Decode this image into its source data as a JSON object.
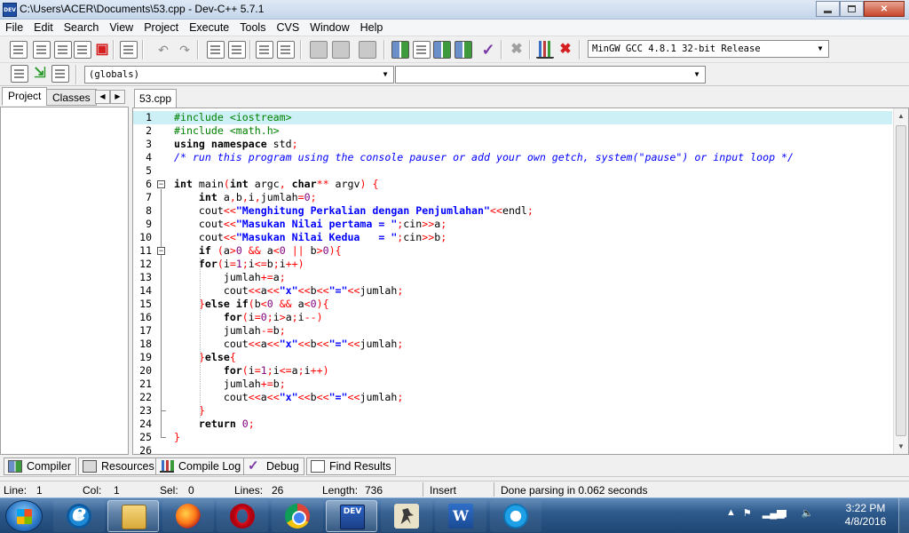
{
  "window": {
    "title": "C:\\Users\\ACER\\Documents\\53.cpp - Dev-C++ 5.7.1",
    "app_icon_label": "DEV"
  },
  "menu": [
    "File",
    "Edit",
    "Search",
    "View",
    "Project",
    "Execute",
    "Tools",
    "CVS",
    "Window",
    "Help"
  ],
  "toolbar": {
    "compiler_select": "MinGW GCC 4.8.1 32-bit Release",
    "globals_select": "(globals)",
    "symbol_select": ""
  },
  "left_panel": {
    "tabs": [
      "Project",
      "Classes"
    ],
    "active_tab": "Project"
  },
  "editor": {
    "file_tab": "53.cpp",
    "current_line": 1,
    "lines": [
      {
        "n": "1",
        "html": "<span class=\"c-pp\">#include &lt;iostream&gt;</span>"
      },
      {
        "n": "2",
        "html": "<span class=\"c-pp\">#include &lt;math.h&gt;</span>"
      },
      {
        "n": "3",
        "html": "<span class=\"c-kw\">using namespace</span> std<span class=\"c-op\">;</span>"
      },
      {
        "n": "4",
        "html": "<span class=\"c-cm\">/* run this program using the console pauser or add your own getch, system(\"pause\") or input loop */</span>"
      },
      {
        "n": "5",
        "html": ""
      },
      {
        "n": "6",
        "html": "<span class=\"c-kw\">int</span> main<span class=\"c-op\">(</span><span class=\"c-kw\">int</span> argc<span class=\"c-op\">,</span> <span class=\"c-kw\">char</span><span class=\"c-op\">**</span> argv<span class=\"c-op\">)</span> <span class=\"c-op\">{</span>"
      },
      {
        "n": "7",
        "html": "    <span class=\"c-kw\">int</span> a<span class=\"c-op\">,</span>b<span class=\"c-op\">,</span>i<span class=\"c-op\">,</span>jumlah<span class=\"c-op\">=</span><span class=\"c-nm\">0</span><span class=\"c-op\">;</span>"
      },
      {
        "n": "8",
        "html": "    cout<span class=\"c-op\">&lt;&lt;</span><span class=\"c-st\">\"Menghitung Perkalian dengan Penjumlahan\"</span><span class=\"c-op\">&lt;&lt;</span>endl<span class=\"c-op\">;</span>"
      },
      {
        "n": "9",
        "html": "    cout<span class=\"c-op\">&lt;&lt;</span><span class=\"c-st\">\"Masukan Nilai pertama = \"</span><span class=\"c-op\">;</span>cin<span class=\"c-op\">&gt;&gt;</span>a<span class=\"c-op\">;</span>"
      },
      {
        "n": "10",
        "html": "    cout<span class=\"c-op\">&lt;&lt;</span><span class=\"c-st\">\"Masukan Nilai Kedua   = \"</span><span class=\"c-op\">;</span>cin<span class=\"c-op\">&gt;&gt;</span>b<span class=\"c-op\">;</span>"
      },
      {
        "n": "11",
        "html": "    <span class=\"c-kw\">if</span> <span class=\"c-op\">(</span>a<span class=\"c-op\">&gt;</span><span class=\"c-nm\">0</span> <span class=\"c-op\">&amp;&amp;</span> a<span class=\"c-op\">&lt;</span><span class=\"c-nm\">0</span> <span class=\"c-op\">||</span> b<span class=\"c-op\">&gt;</span><span class=\"c-nm\">0</span><span class=\"c-op\">){</span>"
      },
      {
        "n": "12",
        "html": "    <span class=\"c-kw\">for</span><span class=\"c-op\">(</span>i<span class=\"c-op\">=</span><span class=\"c-nm\">1</span><span class=\"c-op\">;</span>i<span class=\"c-op\">&lt;=</span>b<span class=\"c-op\">;</span>i<span class=\"c-op\">++)</span>"
      },
      {
        "n": "13",
        "html": "        jumlah<span class=\"c-op\">+=</span>a<span class=\"c-op\">;</span>"
      },
      {
        "n": "14",
        "html": "        cout<span class=\"c-op\">&lt;&lt;</span>a<span class=\"c-op\">&lt;&lt;</span><span class=\"c-st\">\"x\"</span><span class=\"c-op\">&lt;&lt;</span>b<span class=\"c-op\">&lt;&lt;</span><span class=\"c-st\">\"=\"</span><span class=\"c-op\">&lt;&lt;</span>jumlah<span class=\"c-op\">;</span>"
      },
      {
        "n": "15",
        "html": "    <span class=\"c-op\">}</span><span class=\"c-kw\">else if</span><span class=\"c-op\">(</span>b<span class=\"c-op\">&lt;</span><span class=\"c-nm\">0</span> <span class=\"c-op\">&amp;&amp;</span> a<span class=\"c-op\">&lt;</span><span class=\"c-nm\">0</span><span class=\"c-op\">){</span>"
      },
      {
        "n": "16",
        "html": "        <span class=\"c-kw\">for</span><span class=\"c-op\">(</span>i<span class=\"c-op\">=</span><span class=\"c-nm\">0</span><span class=\"c-op\">;</span>i<span class=\"c-op\">&gt;</span>a<span class=\"c-op\">;</span>i<span class=\"c-op\">--)</span>"
      },
      {
        "n": "17",
        "html": "        jumlah<span class=\"c-op\">-=</span>b<span class=\"c-op\">;</span>"
      },
      {
        "n": "18",
        "html": "        cout<span class=\"c-op\">&lt;&lt;</span>a<span class=\"c-op\">&lt;&lt;</span><span class=\"c-st\">\"x\"</span><span class=\"c-op\">&lt;&lt;</span>b<span class=\"c-op\">&lt;&lt;</span><span class=\"c-st\">\"=\"</span><span class=\"c-op\">&lt;&lt;</span>jumlah<span class=\"c-op\">;</span>"
      },
      {
        "n": "19",
        "html": "    <span class=\"c-op\">}</span><span class=\"c-kw\">else</span><span class=\"c-op\">{</span>"
      },
      {
        "n": "20",
        "html": "        <span class=\"c-kw\">for</span><span class=\"c-op\">(</span>i<span class=\"c-op\">=</span><span class=\"c-nm\">1</span><span class=\"c-op\">;</span>i<span class=\"c-op\">&lt;=</span>a<span class=\"c-op\">;</span>i<span class=\"c-op\">++)</span>"
      },
      {
        "n": "21",
        "html": "        jumlah<span class=\"c-op\">+=</span>b<span class=\"c-op\">;</span>"
      },
      {
        "n": "22",
        "html": "        cout<span class=\"c-op\">&lt;&lt;</span>a<span class=\"c-op\">&lt;&lt;</span><span class=\"c-st\">\"x\"</span><span class=\"c-op\">&lt;&lt;</span>b<span class=\"c-op\">&lt;&lt;</span><span class=\"c-st\">\"=\"</span><span class=\"c-op\">&lt;&lt;</span>jumlah<span class=\"c-op\">;</span>"
      },
      {
        "n": "23",
        "html": "    <span class=\"c-op\">}</span>"
      },
      {
        "n": "24",
        "html": "    <span class=\"c-kw\">return</span> <span class=\"c-nm\">0</span><span class=\"c-op\">;</span>"
      },
      {
        "n": "25",
        "html": "<span class=\"c-op\">}</span>"
      },
      {
        "n": "26",
        "html": ""
      }
    ]
  },
  "bottom_tabs": [
    "Compiler",
    "Resources",
    "Compile Log",
    "Debug",
    "Find Results"
  ],
  "status": {
    "line_label": "Line:",
    "line_value": "1",
    "col_label": "Col:",
    "col_value": "1",
    "sel_label": "Sel:",
    "sel_value": "0",
    "lines_label": "Lines:",
    "lines_value": "26",
    "length_label": "Length:",
    "length_value": "736",
    "mode": "Insert",
    "message": "Done parsing in 0.062 seconds"
  },
  "taskbar": {
    "dev_label": "DEV",
    "word_label": "W",
    "time": "3:22 PM",
    "date": "4/8/2016"
  },
  "colors": {
    "current_line": "#ccf0f5",
    "preprocessor": "#008000",
    "comment": "#0000ff",
    "operator": "#ff0000",
    "string": "#0000ff",
    "number": "#800080"
  }
}
